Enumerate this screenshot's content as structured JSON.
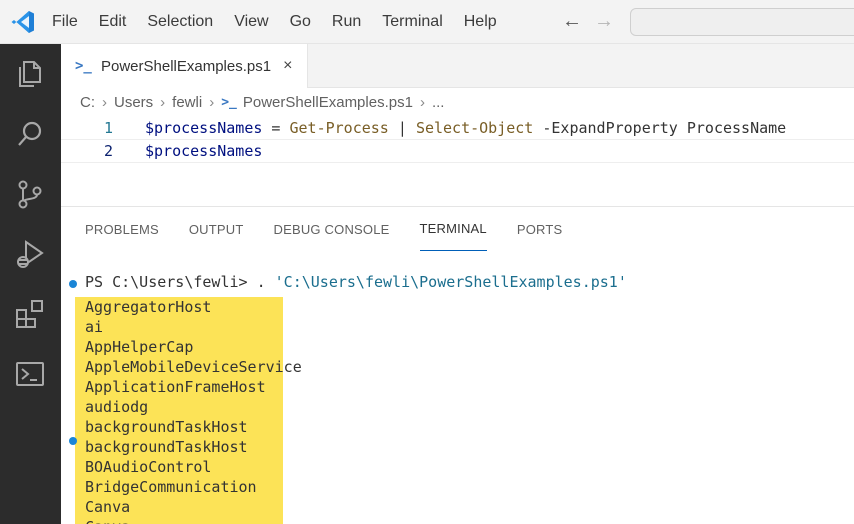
{
  "title_bar": {
    "menu": [
      "File",
      "Edit",
      "Selection",
      "View",
      "Go",
      "Run",
      "Terminal",
      "Help"
    ],
    "back_icon": "arrow-left-icon",
    "forward_icon": "arrow-right-icon"
  },
  "activity_bar": {
    "icons": [
      "explorer-icon",
      "search-icon",
      "source-control-icon",
      "run-debug-icon",
      "extensions-icon",
      "powershell-icon"
    ]
  },
  "tab": {
    "icon": ">_",
    "label": "PowerShellExamples.ps1",
    "close": "×"
  },
  "breadcrumb": {
    "items": [
      "C:",
      "Users",
      "fewli"
    ],
    "file": "PowerShellExamples.ps1",
    "more": "..."
  },
  "editor": {
    "lines": [
      {
        "num": "1",
        "tokens": [
          {
            "t": "$processNames",
            "c": "var"
          },
          {
            "t": " = ",
            "c": "op"
          },
          {
            "t": "Get-Process",
            "c": "cmd"
          },
          {
            "t": " | ",
            "c": "op"
          },
          {
            "t": "Select-Object",
            "c": "cmd"
          },
          {
            "t": " -ExpandProperty ProcessName",
            "c": "param"
          }
        ]
      },
      {
        "num": "2",
        "tokens": [
          {
            "t": "$processNames",
            "c": "var"
          }
        ]
      }
    ]
  },
  "panel": {
    "tabs": [
      "PROBLEMS",
      "OUTPUT",
      "DEBUG CONSOLE",
      "TERMINAL",
      "PORTS"
    ],
    "active_tab": "TERMINAL"
  },
  "terminal": {
    "prompt": "PS C:\\Users\\fewli> . ",
    "command_path": "'C:\\Users\\fewli\\PowerShellExamples.ps1'",
    "output": [
      "AggregatorHost",
      "ai",
      "AppHelperCap",
      "AppleMobileDeviceService",
      "ApplicationFrameHost",
      "audiodg",
      "backgroundTaskHost",
      "backgroundTaskHost",
      "BOAudioControl",
      "BridgeCommunication",
      "Canva",
      "Canva"
    ],
    "highlight_color": "#fce357",
    "dot_color": "#1a85d6"
  }
}
